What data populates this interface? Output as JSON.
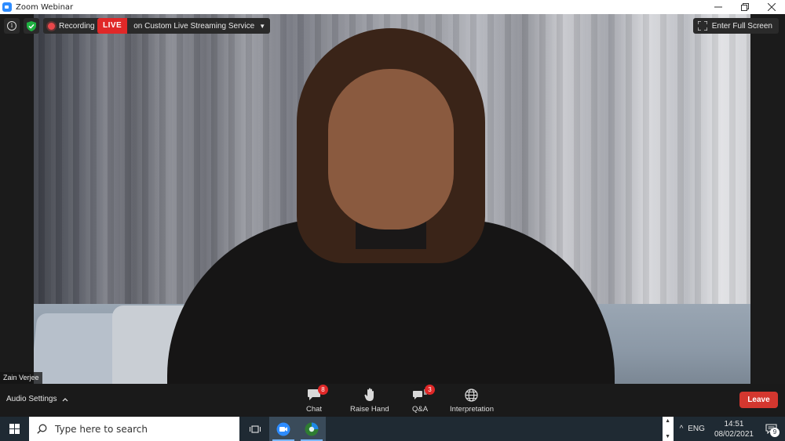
{
  "window": {
    "title": "Zoom Webinar",
    "icon": "zoom-app-icon",
    "controls": [
      "minimize-icon",
      "restore-icon",
      "close-icon"
    ]
  },
  "top_overlay": {
    "info_icon": "info-icon",
    "security_icon": "shield-check-icon",
    "recording_label": "Recording",
    "live_badge": "LIVE",
    "live_text": "on Custom Live Streaming Service",
    "fullscreen_label": "Enter Full Screen"
  },
  "video": {
    "participant_name": "Zain Verjee"
  },
  "toolbar": {
    "audio_settings_label": "Audio Settings",
    "chat_label": "Chat",
    "chat_badge": "8",
    "raise_hand_label": "Raise Hand",
    "qa_label": "Q&A",
    "qa_badge": "3",
    "interpretation_label": "Interpretation",
    "leave_label": "Leave"
  },
  "taskbar": {
    "search_placeholder": "Type here to search",
    "language": "ENG",
    "time": "14:51",
    "date": "08/02/2021",
    "notification_count": "9"
  },
  "colors": {
    "live_red": "#e02828",
    "leave_red": "#d3372f",
    "zoom_blue": "#2d8cff",
    "security_green": "#1fb141"
  }
}
